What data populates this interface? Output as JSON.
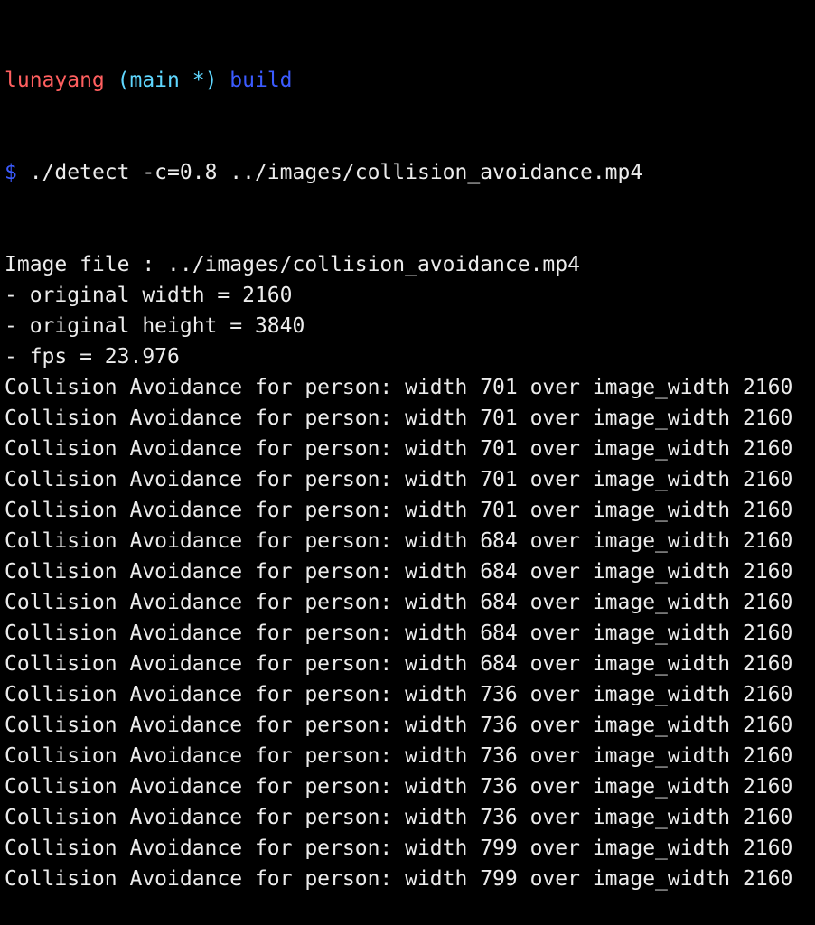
{
  "prompt": {
    "user": "lunayang",
    "branch": "(main *)",
    "directory": "build",
    "symbol": "$",
    "command": " ./detect -c=0.8 ../images/collision_avoidance.mp4"
  },
  "output_lines": [
    "Image file : ../images/collision_avoidance.mp4",
    "- original width = 2160",
    "- original height = 3840",
    "- fps = 23.976",
    "Collision Avoidance for person: width 701 over image_width 2160",
    "Collision Avoidance for person: width 701 over image_width 2160",
    "Collision Avoidance for person: width 701 over image_width 2160",
    "Collision Avoidance for person: width 701 over image_width 2160",
    "Collision Avoidance for person: width 701 over image_width 2160",
    "Collision Avoidance for person: width 684 over image_width 2160",
    "Collision Avoidance for person: width 684 over image_width 2160",
    "Collision Avoidance for person: width 684 over image_width 2160",
    "Collision Avoidance for person: width 684 over image_width 2160",
    "Collision Avoidance for person: width 684 over image_width 2160",
    "Collision Avoidance for person: width 736 over image_width 2160",
    "Collision Avoidance for person: width 736 over image_width 2160",
    "Collision Avoidance for person: width 736 over image_width 2160",
    "Collision Avoidance for person: width 736 over image_width 2160",
    "Collision Avoidance for person: width 736 over image_width 2160",
    "Collision Avoidance for person: width 799 over image_width 2160",
    "Collision Avoidance for person: width 799 over image_width 2160"
  ],
  "colors": {
    "background": "#000000",
    "text": "#ececec",
    "user": "#ff5f5f",
    "branch": "#5fd7ff",
    "directory": "#3b5bff"
  }
}
